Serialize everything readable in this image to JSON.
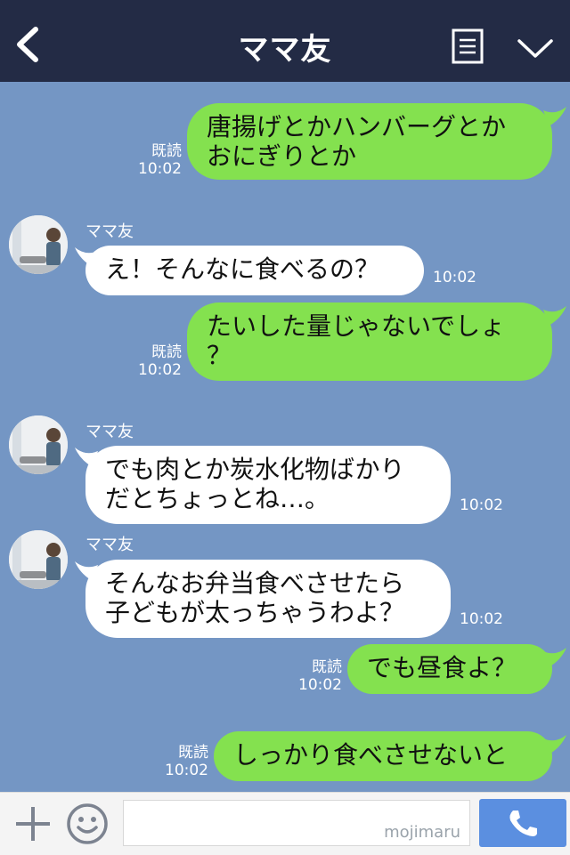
{
  "header": {
    "title": "ママ友"
  },
  "contact_name": "ママ友",
  "read_label": "既読",
  "messages": [
    {
      "from": "me",
      "lines": [
        "唐揚げとかハンバーグとか",
        "おにぎりとか"
      ],
      "read": "既読",
      "time": "10:02"
    },
    {
      "from": "them",
      "sender": "ママ友",
      "lines": [
        "え！そんなに食べるの？"
      ],
      "time": "10:02"
    },
    {
      "from": "me",
      "lines": [
        "たいした量じゃないでしょ",
        "？"
      ],
      "read": "既読",
      "time": "10:02"
    },
    {
      "from": "them",
      "sender": "ママ友",
      "lines": [
        "でも肉とか炭水化物ばかり",
        "だとちょっとね…。"
      ],
      "time": "10:02"
    },
    {
      "from": "them",
      "sender": "ママ友",
      "lines": [
        "そんなお弁当食べさせたら",
        "子どもが太っちゃうわよ？"
      ],
      "time": "10:02"
    },
    {
      "from": "me",
      "lines": [
        "でも昼食よ？"
      ],
      "read": "既読",
      "time": "10:02"
    },
    {
      "from": "me",
      "lines": [
        "しっかり食べさせないと"
      ],
      "read": "既読",
      "time": "10:02"
    }
  ],
  "footer": {
    "watermark": "mojimaru"
  },
  "colors": {
    "header_bg": "#232b45",
    "chat_bg": "#7496c4",
    "my_bubble": "#84e14f",
    "their_bubble": "#ffffff",
    "send_button": "#5b8fe0"
  },
  "icons": [
    "back-arrow-icon",
    "notes-icon",
    "chevron-down-icon",
    "plus-icon",
    "smile-icon",
    "phone-icon"
  ]
}
